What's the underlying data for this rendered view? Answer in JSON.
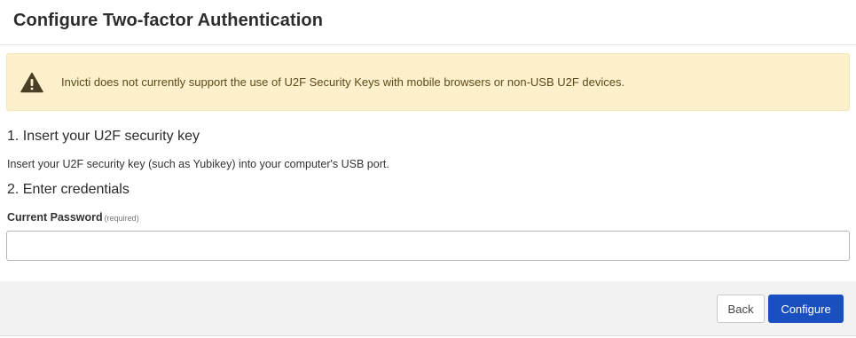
{
  "modal": {
    "title": "Configure Two-factor Authentication"
  },
  "alert": {
    "icon": "warning-triangle-icon",
    "message": "Invicti does not currently support the use of U2F Security Keys with mobile browsers or non-USB U2F devices.",
    "background_color": "#fdf0cc",
    "text_color": "#5c4a1a"
  },
  "steps": [
    {
      "title": "1. Insert your U2F security key",
      "description": "Insert your U2F security key (such as Yubikey) into your computer's USB port."
    },
    {
      "title": "2. Enter credentials"
    }
  ],
  "form": {
    "password_label": "Current Password",
    "required_note": "(required)",
    "password_value": "",
    "password_placeholder": ""
  },
  "footer": {
    "back_label": "Back",
    "configure_label": "Configure",
    "primary_color": "#1a4fc0"
  }
}
